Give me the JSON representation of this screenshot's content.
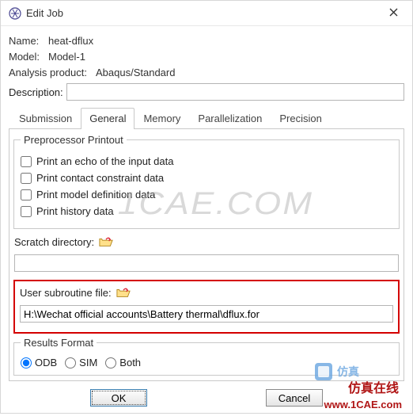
{
  "window": {
    "title": "Edit Job"
  },
  "fields": {
    "name_label": "Name:",
    "name_value": "heat-dflux",
    "model_label": "Model:",
    "model_value": "Model-1",
    "analysis_label": "Analysis product:",
    "analysis_value": "Abaqus/Standard",
    "description_label": "Description:",
    "description_value": ""
  },
  "tabs": {
    "submission": "Submission",
    "general": "General",
    "memory": "Memory",
    "parallelization": "Parallelization",
    "precision": "Precision"
  },
  "preproc": {
    "legend": "Preprocessor Printout",
    "echo": "Print an echo of the input data",
    "contact": "Print contact constraint data",
    "modeldef": "Print model definition data",
    "history": "Print history data"
  },
  "scratch": {
    "label": "Scratch directory:",
    "value": ""
  },
  "usersub": {
    "label": "User subroutine file:",
    "value": "H:\\Wechat official accounts\\Battery thermal\\dflux.for"
  },
  "results": {
    "legend": "Results Format",
    "odb": "ODB",
    "sim": "SIM",
    "both": "Both"
  },
  "buttons": {
    "ok": "OK",
    "cancel": "Cancel"
  },
  "icons": {
    "app": "abaqus-icon",
    "close": "close-icon",
    "folder": "folder-open-icon"
  },
  "watermarks": {
    "center": "1CAE.COM",
    "brand": "仿真在线",
    "url": "www.1CAE.com"
  }
}
